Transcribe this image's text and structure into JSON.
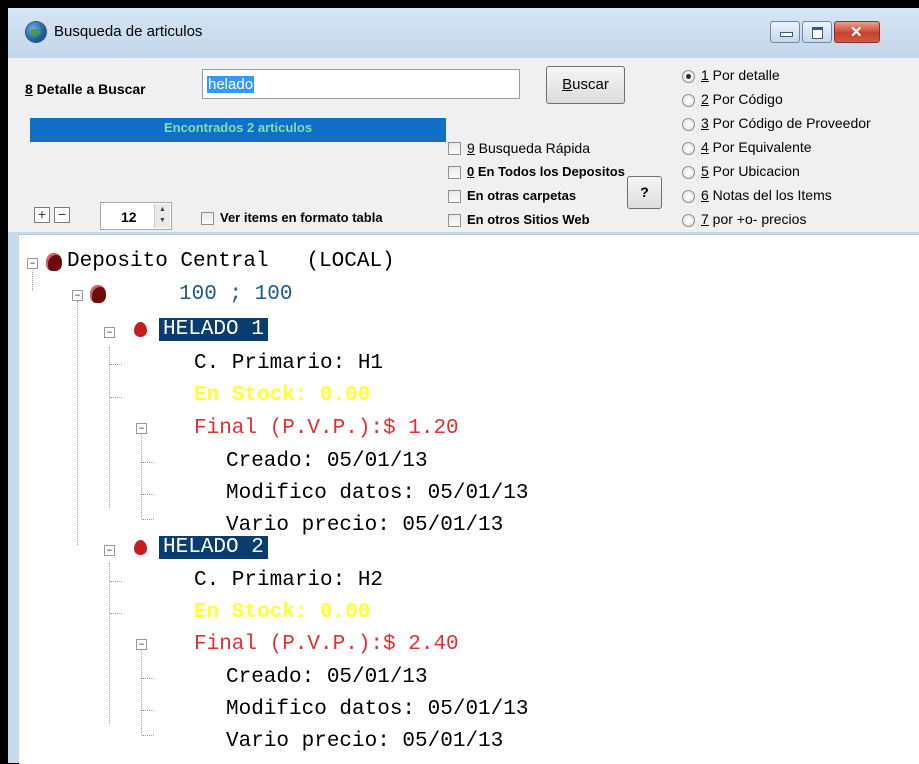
{
  "window": {
    "title": "Busqueda de articulos"
  },
  "search": {
    "label": "8 Detalle a Buscar",
    "value": "helado",
    "button": "Buscar"
  },
  "status": "Encontrados 2 articulos",
  "options": {
    "rapida": "9 Busqueda Rápida",
    "todos": "0 En Todos los Depositos",
    "carpetas": "En otras carpetas",
    "sitios": "En otros Sitios Web",
    "help": "?",
    "tabla": "Ver items en formato tabla",
    "count": "12"
  },
  "radios": [
    "1 Por detalle",
    "2 Por Código",
    "3 Por Código de Proveedor",
    "4 Por Equivalente",
    "5 Por Ubicacion",
    "6 Notas del los Items",
    "7 por +o- precios"
  ],
  "tree": {
    "root": "Deposito Central   (LOCAL)",
    "group": "100 ; 100",
    "items": [
      {
        "name": "HELADO 1",
        "primario": "C. Primario: H1",
        "stock": "En Stock: 0.00",
        "final": "Final (P.V.P.):$ 1.20",
        "creado": "Creado: 05/01/13",
        "modifico": "Modifico datos: 05/01/13",
        "vario": "Vario precio: 05/01/13"
      },
      {
        "name": "HELADO 2",
        "primario": "C. Primario: H2",
        "stock": "En Stock: 0.00",
        "final": "Final (P.V.P.):$ 2.40",
        "creado": "Creado: 05/01/13",
        "modifico": "Modifico datos: 05/01/13",
        "vario": "Vario precio: 05/01/13"
      }
    ]
  },
  "colors": {
    "selection": "#0a3d6e",
    "status_bar": "#1070c8",
    "status_text": "#7ee0b0",
    "stock_text": "#ffff33",
    "price_text": "#e03030",
    "group_text": "#205a8a"
  }
}
